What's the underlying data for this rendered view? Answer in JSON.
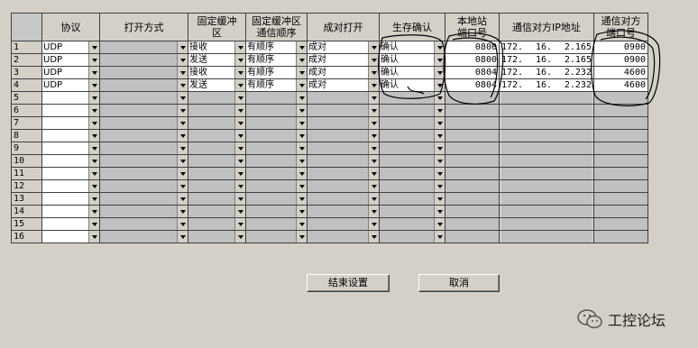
{
  "headers": [
    "协议",
    "打开方式",
    "固定缓冲\n区",
    "固定缓冲区\n通信顺序",
    "成对打开",
    "生存确认",
    "本地站\n端口号",
    "通信对方IP地址",
    "通信对方\n端口号"
  ],
  "rows": [
    {
      "n": "1",
      "protocol": "UDP",
      "open": "",
      "buffer": "接收",
      "order": "有顺序",
      "pair": "成对",
      "alive": "确认",
      "port": "0800",
      "ip": [
        "172.",
        "16.",
        "2.165"
      ],
      "rport": "0900"
    },
    {
      "n": "2",
      "protocol": "UDP",
      "open": "",
      "buffer": "发送",
      "order": "有顺序",
      "pair": "成对",
      "alive": "确认",
      "port": "0800",
      "ip": [
        "172.",
        "16.",
        "2.165"
      ],
      "rport": "0900"
    },
    {
      "n": "3",
      "protocol": "UDP",
      "open": "",
      "buffer": "接收",
      "order": "有顺序",
      "pair": "成对",
      "alive": "确认",
      "port": "0804",
      "ip": [
        "172.",
        "16.",
        "2.232"
      ],
      "rport": "4600"
    },
    {
      "n": "4",
      "protocol": "UDP",
      "open": "",
      "buffer": "发送",
      "order": "有顺序",
      "pair": "成对",
      "alive": "确认",
      "port": "0804",
      "ip": [
        "172.",
        "16.",
        "2.232"
      ],
      "rport": "4600"
    },
    {
      "n": "5"
    },
    {
      "n": "6"
    },
    {
      "n": "7"
    },
    {
      "n": "8"
    },
    {
      "n": "9"
    },
    {
      "n": "10"
    },
    {
      "n": "11"
    },
    {
      "n": "12"
    },
    {
      "n": "13"
    },
    {
      "n": "14"
    },
    {
      "n": "15"
    },
    {
      "n": "16"
    }
  ],
  "buttons": {
    "finish": "结束设置",
    "cancel": "取消"
  },
  "watermark": "工控论坛"
}
